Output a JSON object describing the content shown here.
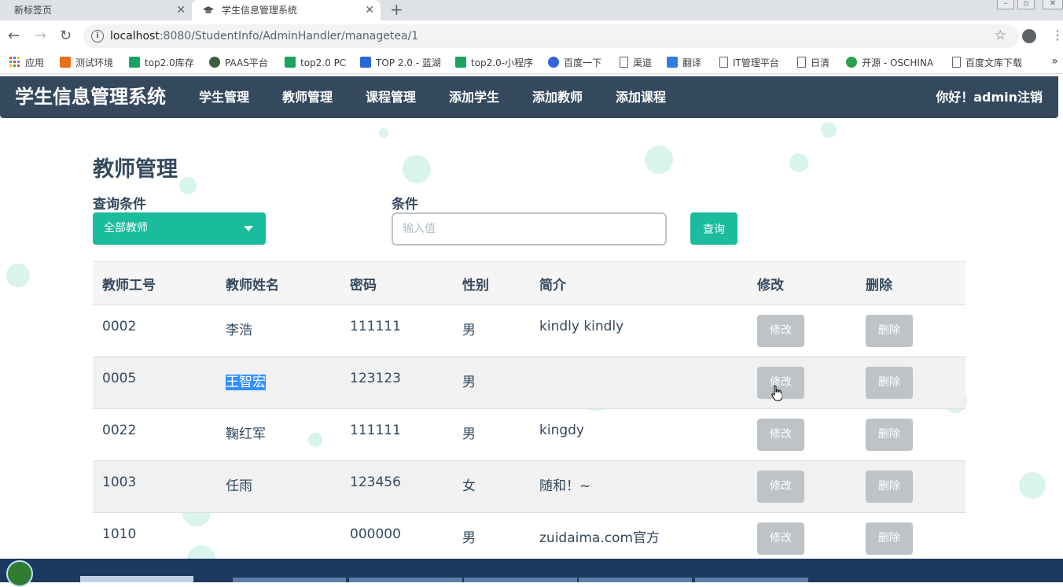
{
  "browser": {
    "tabs": [
      {
        "title": "新标签页",
        "close": "✕"
      },
      {
        "title": "学生信息管理系统",
        "close": "✕"
      }
    ],
    "new_tab": "+",
    "url_host": "localhost",
    "url_rest": ":8080/StudentInfo/AdminHandler/managetea/1",
    "bookmarks": [
      {
        "label": "应用",
        "icon": "apps-grid-icon"
      },
      {
        "label": "测试环境",
        "icon": "u-logo-icon",
        "color": "#e8701a"
      },
      {
        "label": "top2.0库存",
        "icon": "play-icon",
        "color": "#1aa260"
      },
      {
        "label": "PAAS平台",
        "icon": "paas-logo-icon",
        "color": "#3e5f3e"
      },
      {
        "label": "top2.0 PC",
        "icon": "play-icon",
        "color": "#1aa260"
      },
      {
        "label": "TOP 2.0 - 蓝湖",
        "icon": "lanhu-logo-icon",
        "color": "#2a66d8"
      },
      {
        "label": "top2.0-小程序",
        "icon": "play-icon",
        "color": "#1aa260"
      },
      {
        "label": "百度一下",
        "icon": "baidu-paw-icon",
        "color": "#3264dd"
      },
      {
        "label": "渠道",
        "icon": "document-icon"
      },
      {
        "label": "翻译",
        "icon": "translate-icon",
        "color": "#2f7de1"
      },
      {
        "label": "IT管理平台",
        "icon": "document-icon"
      },
      {
        "label": "日清",
        "icon": "document-icon"
      },
      {
        "label": "开源 - OSCHINA",
        "icon": "oschina-logo-icon",
        "color": "#2aa14a"
      },
      {
        "label": "百度文库下载",
        "icon": "document-icon"
      }
    ],
    "bookmarks_more": "»"
  },
  "navbar": {
    "brand": "学生信息管理系统",
    "links": [
      "学生管理",
      "教师管理",
      "课程管理",
      "添加学生",
      "添加教师",
      "添加课程"
    ],
    "greeting": "你好！admin注销"
  },
  "main": {
    "title": "教师管理",
    "query_label": "查询条件",
    "condition_label": "条件",
    "select_value": "全部教师",
    "input_placeholder": "输入值",
    "query_button": "查询"
  },
  "table": {
    "headers": [
      "教师工号",
      "教师姓名",
      "密码",
      "性别",
      "简介",
      "修改",
      "删除"
    ],
    "rows": [
      {
        "id": "0002",
        "name": "李浩",
        "password": "111111",
        "gender": "男",
        "intro": "kindly kindly",
        "edit": "修改",
        "delete": "删除"
      },
      {
        "id": "0005",
        "name": "王智宏",
        "password": "123123",
        "gender": "男",
        "intro": "",
        "edit": "修改",
        "delete": "删除"
      },
      {
        "id": "0022",
        "name": "鞠红军",
        "password": "111111",
        "gender": "男",
        "intro": "kingdy",
        "edit": "修改",
        "delete": "删除"
      },
      {
        "id": "1003",
        "name": "任雨",
        "password": "123456",
        "gender": "女",
        "intro": "随和！~",
        "edit": "修改",
        "delete": "删除"
      },
      {
        "id": "1010",
        "name": "",
        "password": "000000",
        "gender": "男",
        "intro": "zuidaima.com官方",
        "edit": "修改",
        "delete": "删除"
      }
    ]
  },
  "colors": {
    "navbar": "#34495e",
    "accent": "#1abc9c",
    "disabled_button": "#bdc3c7"
  }
}
